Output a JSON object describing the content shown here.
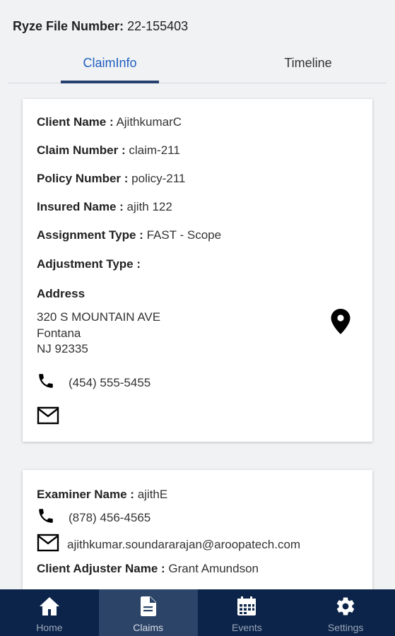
{
  "header": {
    "file_number_label": "Ryze File Number:",
    "file_number_value": "22-155403"
  },
  "tabs": [
    {
      "label": "ClaimInfo",
      "active": true
    },
    {
      "label": "Timeline",
      "active": false
    }
  ],
  "claim_card": {
    "client_name_label": "Client Name :",
    "client_name_value": "AjithkumarC",
    "claim_number_label": "Claim Number :",
    "claim_number_value": "claim-211",
    "policy_number_label": "Policy Number :",
    "policy_number_value": "policy-211",
    "insured_name_label": "Insured Name :",
    "insured_name_value": "ajith 122",
    "assignment_type_label": "Assignment Type :",
    "assignment_type_value": "FAST - Scope",
    "adjustment_type_label": "Adjustment Type :",
    "adjustment_type_value": "",
    "address_label": "Address",
    "address_line1": "320 S MOUNTAIN AVE",
    "address_line2": "Fontana",
    "address_line3": "NJ 92335",
    "phone": "(454) 555-5455"
  },
  "examiner_card": {
    "examiner_name_label": "Examiner Name :",
    "examiner_name_value": "ajithE",
    "phone": "(878) 456-4565",
    "email": "ajithkumar.soundararajan@aroopatech.com",
    "client_adjuster_label": "Client Adjuster Name :",
    "client_adjuster_value": "Grant Amundson"
  },
  "bottom_nav": {
    "items": [
      {
        "label": "Home",
        "icon": "home-icon",
        "active": false
      },
      {
        "label": "Claims",
        "icon": "document-icon",
        "active": true
      },
      {
        "label": "Events",
        "icon": "calendar-icon",
        "active": false
      },
      {
        "label": "Settings",
        "icon": "gear-icon",
        "active": false
      }
    ]
  },
  "colors": {
    "background": "#f1f2f4",
    "active_tab_text": "#1f5fbf",
    "active_tab_underline": "#26416f",
    "nav_background": "#0c2449",
    "nav_active_background": "#2c4468"
  }
}
